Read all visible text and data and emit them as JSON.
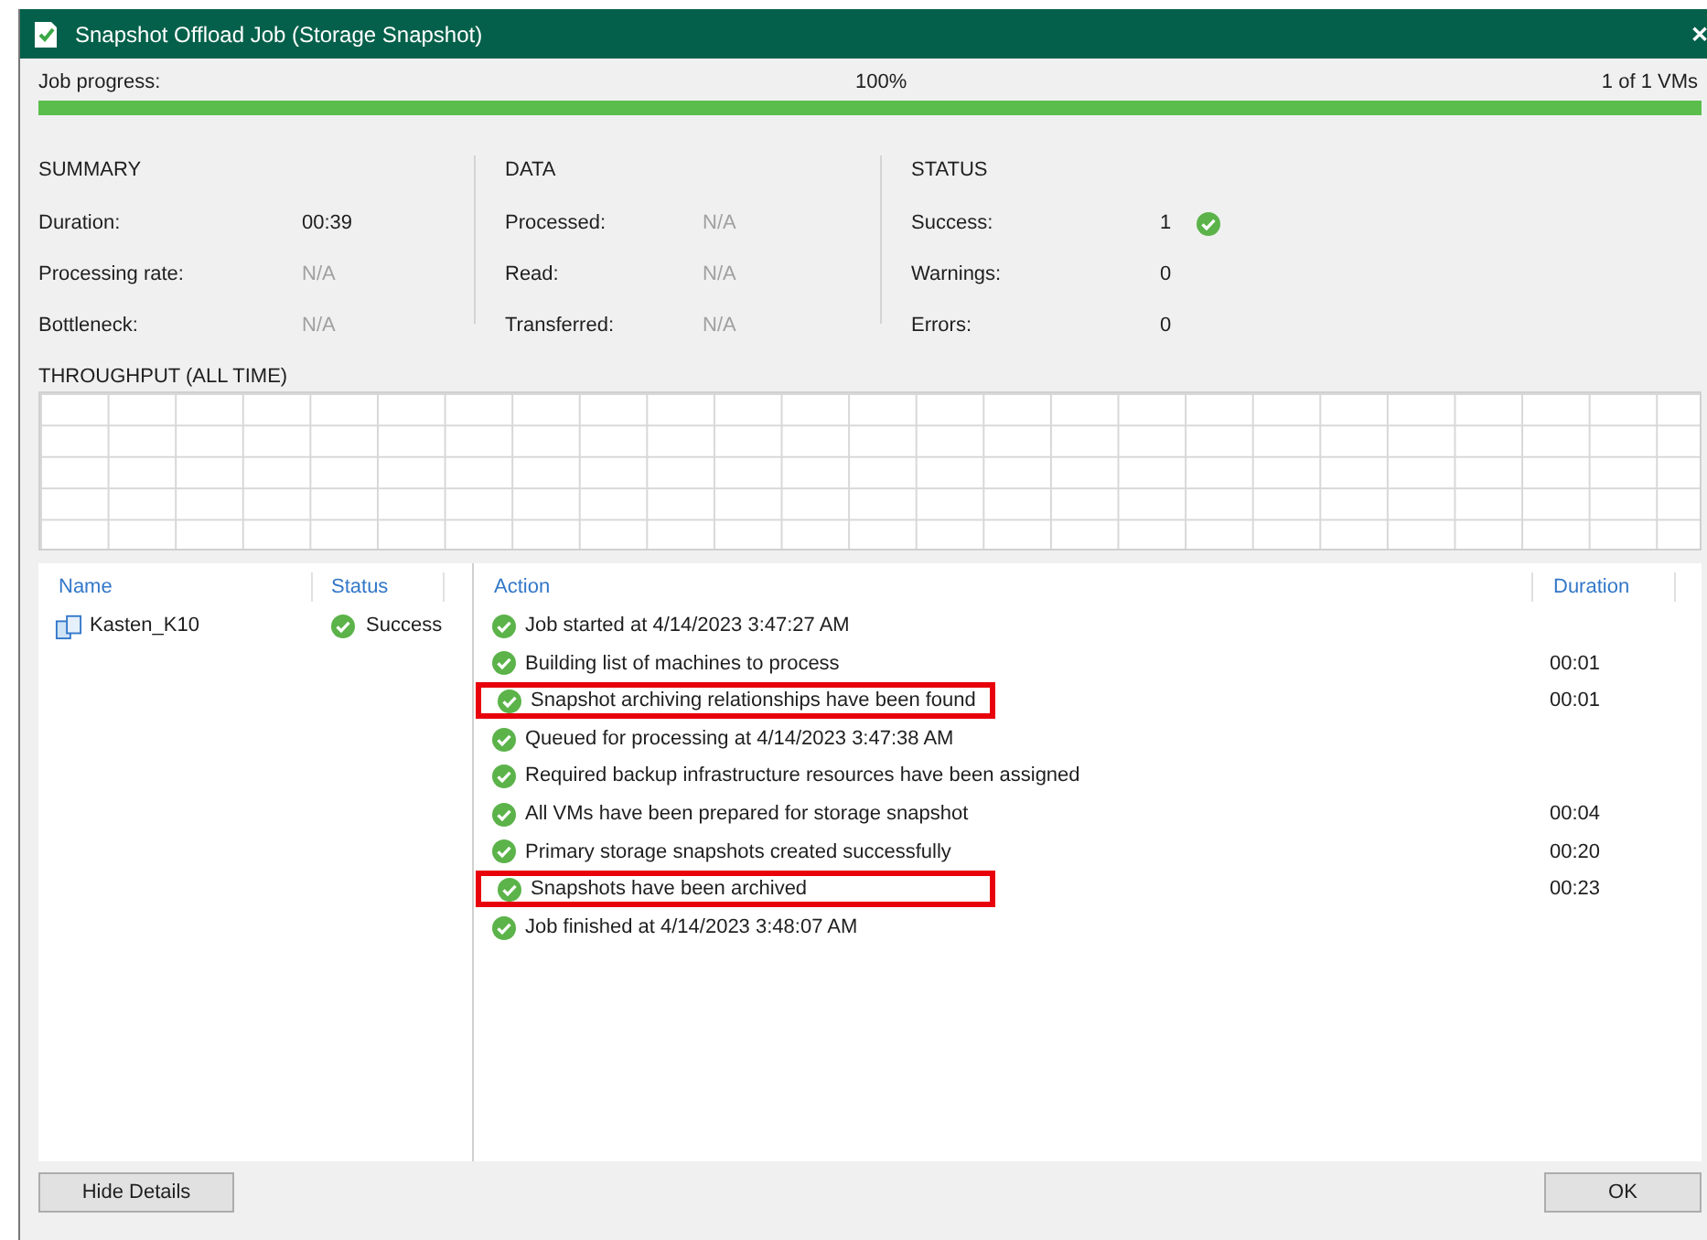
{
  "window": {
    "title": "Snapshot Offload Job (Storage Snapshot)",
    "close": "✕"
  },
  "progress": {
    "label": "Job progress:",
    "percent": "100%",
    "count": "1 of 1 VMs",
    "level": 1
  },
  "summary": {
    "heading": "SUMMARY",
    "rows": [
      {
        "label": "Duration:",
        "value": "00:39",
        "dim": false
      },
      {
        "label": "Processing rate:",
        "value": "N/A",
        "dim": true
      },
      {
        "label": "Bottleneck:",
        "value": "N/A",
        "dim": true
      }
    ]
  },
  "data": {
    "heading": "DATA",
    "rows": [
      {
        "label": "Processed:",
        "value": "N/A",
        "dim": true
      },
      {
        "label": "Read:",
        "value": "N/A",
        "dim": true
      },
      {
        "label": "Transferred:",
        "value": "N/A",
        "dim": true
      }
    ]
  },
  "status": {
    "heading": "STATUS",
    "rows": [
      {
        "label": "Success:",
        "value": "1",
        "ok_icon": true
      },
      {
        "label": "Warnings:",
        "value": "0",
        "ok_icon": false
      },
      {
        "label": "Errors:",
        "value": "0",
        "ok_icon": false
      }
    ]
  },
  "throughput": {
    "heading": "THROUGHPUT (ALL TIME)"
  },
  "vm_table": {
    "columns": [
      "Name",
      "Status"
    ],
    "rows": [
      {
        "name": "Kasten_K10",
        "status": "Success"
      }
    ]
  },
  "action_table": {
    "columns": [
      "Action",
      "Duration"
    ],
    "rows": [
      {
        "action": "Job started at 4/14/2023 3:47:27 AM",
        "duration": null,
        "highlighted": false
      },
      {
        "action": "Building list of machines to process",
        "duration": "00:01",
        "highlighted": false
      },
      {
        "action": "Snapshot archiving relationships have been found",
        "duration": "00:01",
        "highlighted": true
      },
      {
        "action": "Queued for processing at 4/14/2023 3:47:38 AM",
        "duration": null,
        "highlighted": false
      },
      {
        "action": "Required backup infrastructure resources have been assigned",
        "duration": null,
        "highlighted": false
      },
      {
        "action": "All VMs have been prepared for storage snapshot",
        "duration": "00:04",
        "highlighted": false
      },
      {
        "action": "Primary storage snapshots created successfully",
        "duration": "00:20",
        "highlighted": false
      },
      {
        "action": "Snapshots have been archived",
        "duration": "00:23",
        "highlighted": true
      },
      {
        "action": "Job finished at 4/14/2023 3:48:07 AM",
        "duration": null,
        "highlighted": false
      }
    ]
  },
  "buttons": {
    "left": "Hide Details",
    "right": "OK"
  }
}
